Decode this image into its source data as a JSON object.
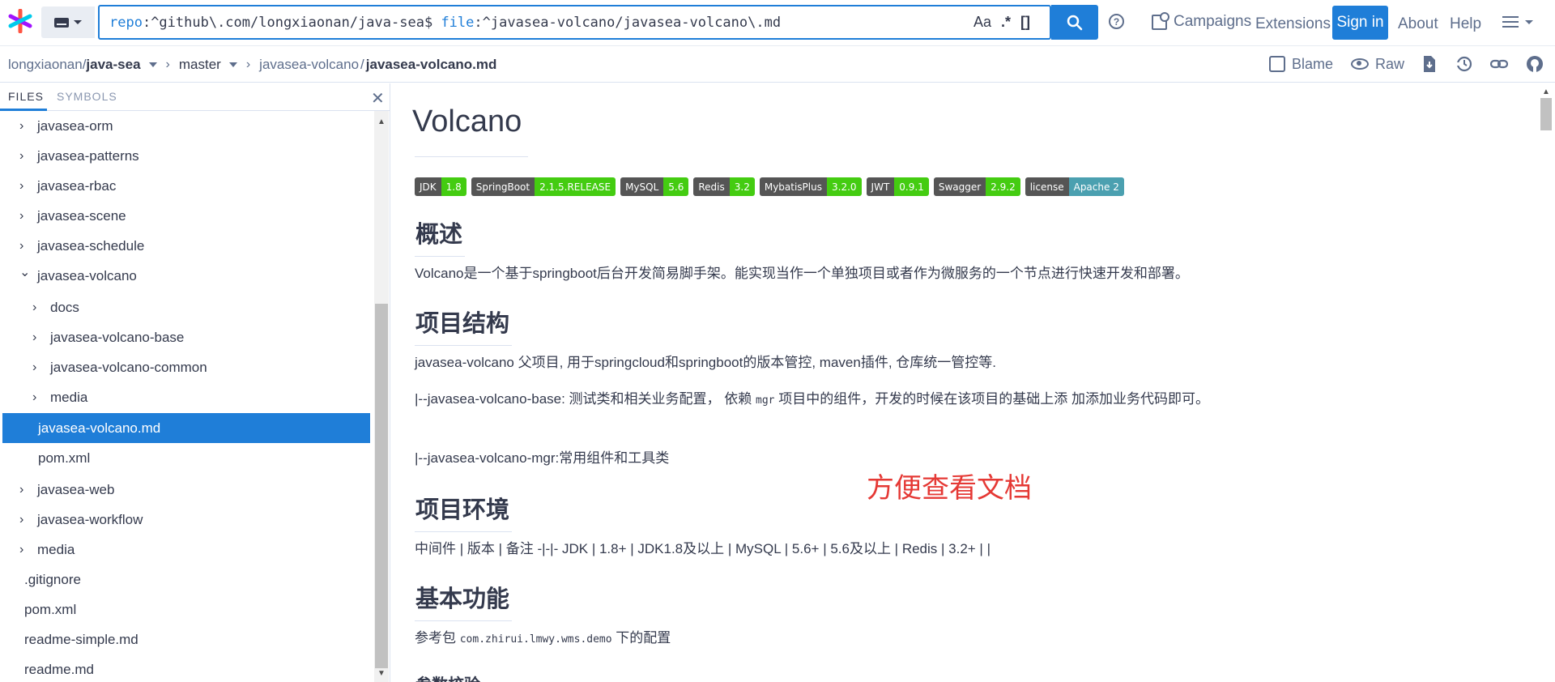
{
  "search": {
    "repo_kw": "repo",
    "repo_val": ":^github\\.com/longxiaonan/java-sea$",
    "file_kw": "file",
    "file_val": ":^javasea-volcano/javasea-volcano\\.md",
    "opt_case": "Aa",
    "opt_regex": ".*",
    "opt_struct": "[]"
  },
  "nav": {
    "campaigns": "Campaigns",
    "extensions": "Extensions",
    "signin": "Sign in",
    "about": "About",
    "help": "Help"
  },
  "breadcrumb": {
    "owner": "longxiaonan/",
    "repo": "java-sea",
    "branch": "master",
    "dir": "javasea-volcano",
    "sep": "/",
    "file": "javasea-volcano.md"
  },
  "file_actions": {
    "blame": "Blame",
    "raw": "Raw"
  },
  "sidebar": {
    "tab_files": "FILES",
    "tab_symbols": "SYMBOLS",
    "items": [
      {
        "label": "javasea-orm",
        "arrow": "›"
      },
      {
        "label": "javasea-patterns",
        "arrow": "›"
      },
      {
        "label": "javasea-rbac",
        "arrow": "›"
      },
      {
        "label": "javasea-scene",
        "arrow": "›"
      },
      {
        "label": "javasea-schedule",
        "arrow": "›"
      },
      {
        "label": "javasea-volcano",
        "arrow": "⌄"
      },
      {
        "label": "docs",
        "arrow": "›"
      },
      {
        "label": "javasea-volcano-base",
        "arrow": "›"
      },
      {
        "label": "javasea-volcano-common",
        "arrow": "›"
      },
      {
        "label": "media",
        "arrow": "›"
      },
      {
        "label": "javasea-volcano.md",
        "arrow": ""
      },
      {
        "label": "pom.xml",
        "arrow": ""
      },
      {
        "label": "javasea-web",
        "arrow": "›"
      },
      {
        "label": "javasea-workflow",
        "arrow": "›"
      },
      {
        "label": "media",
        "arrow": "›"
      },
      {
        "label": ".gitignore",
        "arrow": ""
      },
      {
        "label": "pom.xml",
        "arrow": ""
      },
      {
        "label": "readme-simple.md",
        "arrow": ""
      },
      {
        "label": "readme.md",
        "arrow": ""
      }
    ]
  },
  "doc": {
    "title": "Volcano",
    "badges": [
      {
        "l": "JDK",
        "r": "1.8",
        "color": "#4c1"
      },
      {
        "l": "SpringBoot",
        "r": "2.1.5.RELEASE",
        "color": "#4c1"
      },
      {
        "l": "MySQL",
        "r": "5.6",
        "color": "#4c1"
      },
      {
        "l": "Redis",
        "r": "3.2",
        "color": "#4c1"
      },
      {
        "l": "MybatisPlus",
        "r": "3.2.0",
        "color": "#4c1"
      },
      {
        "l": "JWT",
        "r": "0.9.1",
        "color": "#4c1"
      },
      {
        "l": "Swagger",
        "r": "2.9.2",
        "color": "#4c1"
      },
      {
        "l": "license",
        "r": "Apache 2",
        "color": "#4ba0b0"
      }
    ],
    "h_overview": "概述",
    "p_overview": "Volcano是一个基于springboot后台开发简易脚手架。能实现当作一个单独项目或者作为微服务的一个节点进行快速开发和部署。",
    "h_structure": "项目结构",
    "p_struct1": "javasea-volcano 父项目, 用于springcloud和springboot的版本管控, maven插件, 仓库统一管控等.",
    "p_struct2_a": "|--javasea-volcano-base: 测试类和相关业务配置， 依赖 ",
    "p_struct2_code": "mgr",
    "p_struct2_b": " 项目中的组件，开发的时候在该项目的基础上添 加添加业务代码即可。",
    "p_struct3": "|--javasea-volcano-mgr:常用组件和工具类",
    "h_env": "项目环境",
    "p_env": "中间件 | 版本 | 备注 -|-|- JDK | 1.8+ | JDK1.8及以上 | MySQL | 5.6+ | 5.6及以上 | Redis | 3.2+ | |",
    "h_func": "基本功能",
    "p_func_a": "参考包 ",
    "p_func_code": "com.zhirui.lmwy.wms.demo",
    "p_func_b": " 下的配置",
    "h_next": "参数校验"
  },
  "annotation": "方便查看文档",
  "colors": {
    "accent": "#1f7ed8",
    "annotation": "#e53935",
    "badge_green": "#4c1",
    "badge_teal": "#4ba0b0"
  }
}
